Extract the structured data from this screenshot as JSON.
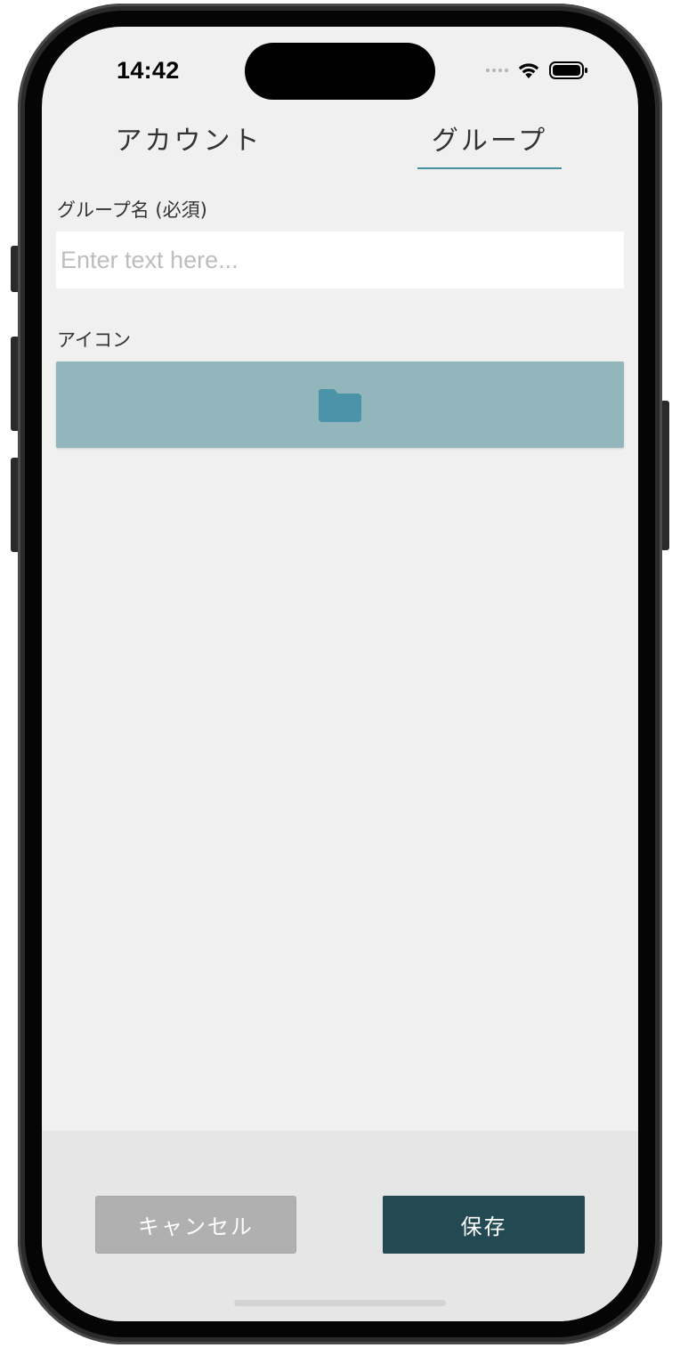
{
  "status_bar": {
    "time": "14:42"
  },
  "tabs": [
    {
      "label": "アカウント",
      "selected": false
    },
    {
      "label": "グループ",
      "selected": true
    }
  ],
  "form": {
    "group_name_label": "グループ名 (必須)",
    "group_name_placeholder": "Enter text here...",
    "group_name_value": "",
    "icon_label": "アイコン",
    "icon_name": "folder-icon"
  },
  "actions": {
    "cancel_label": "キャンセル",
    "save_label": "保存"
  },
  "colors": {
    "accent": "#4a8ea3",
    "icon_picker_bg": "#93b6bd",
    "folder_icon": "#4a93a8",
    "save_button": "#234a52",
    "cancel_button": "#b0b0b0"
  }
}
